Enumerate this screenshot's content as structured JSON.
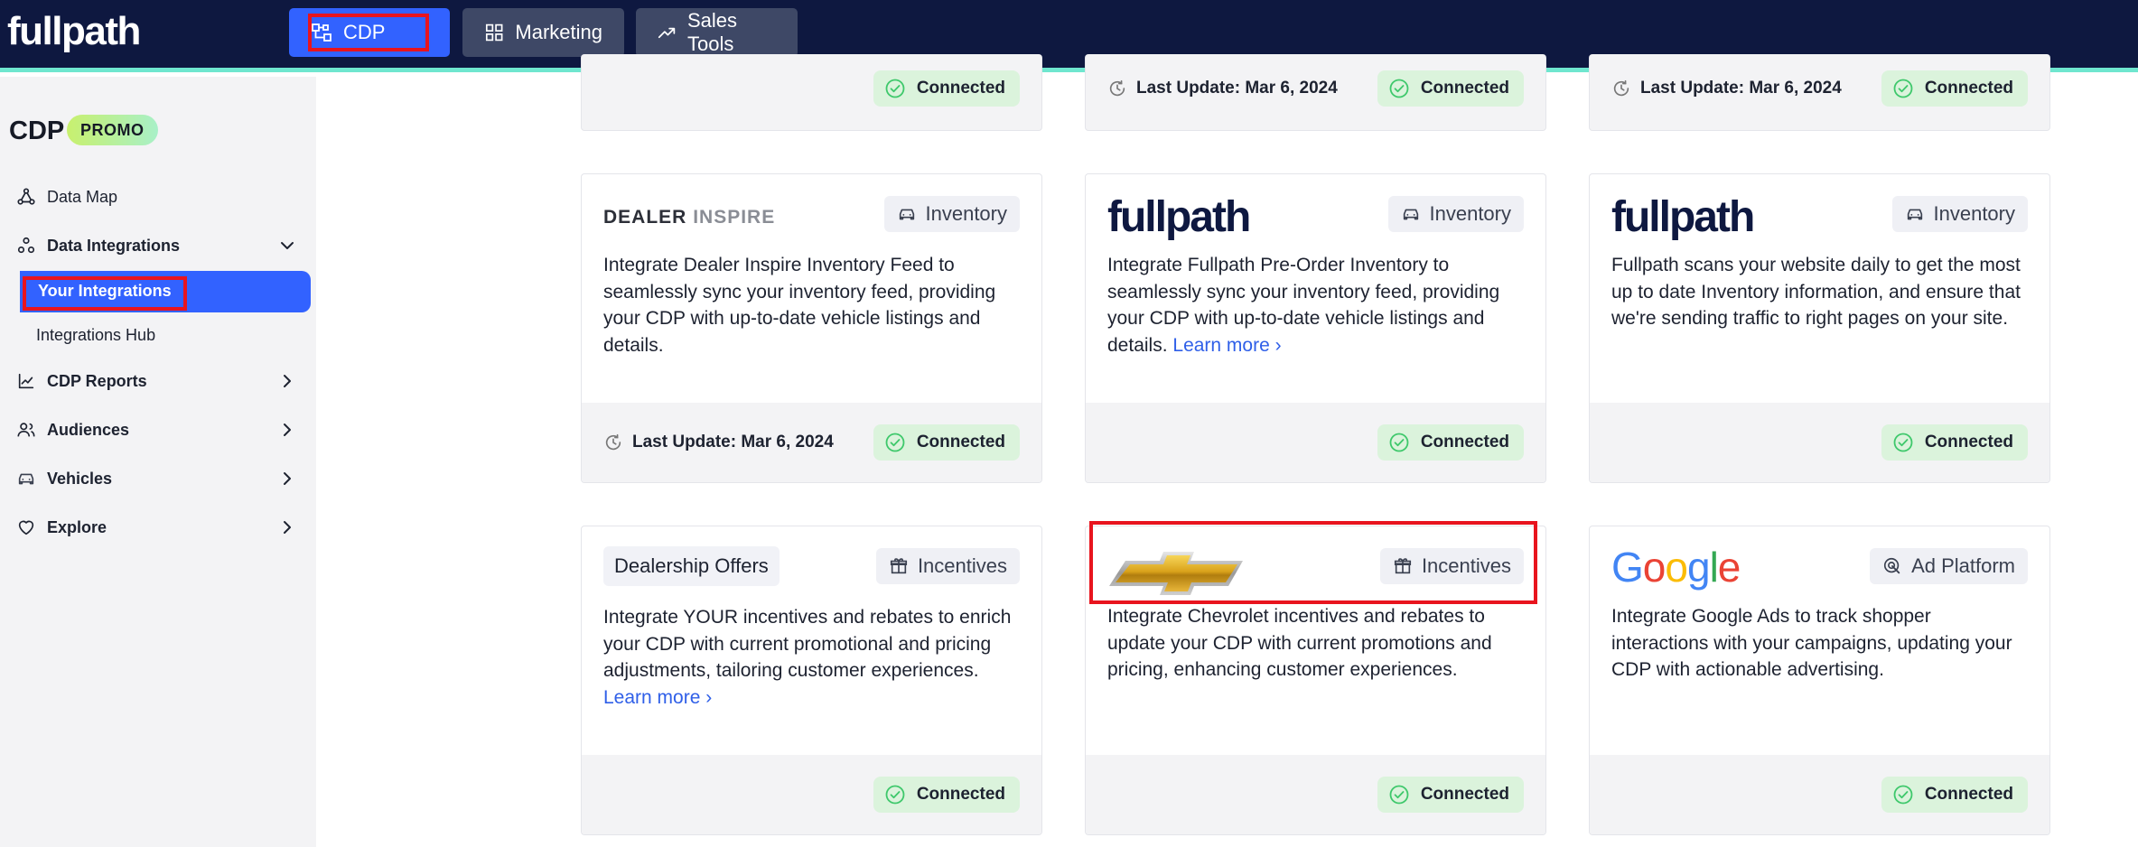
{
  "app": {
    "logo": "fullpath"
  },
  "topnav": [
    {
      "label": "CDP",
      "icon": "cdp-icon",
      "active": true
    },
    {
      "label": "Marketing",
      "icon": "grid-icon",
      "active": false
    },
    {
      "label": "Sales Tools",
      "icon": "trending-up-icon",
      "active": false
    }
  ],
  "sidebar": {
    "title": "CDP",
    "badge": "PROMO",
    "items": [
      {
        "label": "Data Map",
        "icon": "data-map-icon"
      },
      {
        "label": "Data Integrations",
        "icon": "integrations-icon",
        "expanded": true,
        "children": [
          {
            "label": "Your Integrations",
            "active": true
          },
          {
            "label": "Integrations Hub"
          }
        ]
      },
      {
        "label": "CDP Reports",
        "icon": "reports-icon"
      },
      {
        "label": "Audiences",
        "icon": "audiences-icon"
      },
      {
        "label": "Vehicles",
        "icon": "car-icon"
      },
      {
        "label": "Explore",
        "icon": "heart-icon"
      }
    ]
  },
  "status": {
    "connected": "Connected",
    "learn_more": "Learn more ›",
    "last_update": "Last Update: Mar 6, 2024"
  },
  "cards": [
    {
      "logo": "DEALER INSPIRE",
      "logo_a": "DEALER ",
      "logo_b": "INSPIRE",
      "tag": "Inventory",
      "desc": "Integrate Dealer Inspire Inventory Feed to seamlessly sync your inventory feed, providing your CDP with up-to-date vehicle listings and details."
    },
    {
      "logo": "fullpath",
      "tag": "Inventory",
      "desc": "Integrate Fullpath Pre-Order Inventory to seamlessly sync your inventory feed, providing your CDP with up-to-date vehicle listings and details."
    },
    {
      "logo": "fullpath",
      "tag": "Inventory",
      "desc": "Fullpath scans your website daily to get the most up to date Inventory information, and ensure that we're sending traffic to right pages on your site."
    },
    {
      "logo": "Dealership Offers",
      "tag": "Incentives",
      "desc": "Integrate YOUR incentives and rebates to enrich your CDP with current promotional and pricing adjustments, tailoring customer experiences."
    },
    {
      "logo": "chevrolet-bowtie",
      "tag": "Incentives",
      "desc": "Integrate Chevrolet incentives and rebates to update your CDP with current promotions and pricing, enhancing customer experiences."
    },
    {
      "logo": "Google",
      "tag": "Ad Platform",
      "desc": "Integrate Google Ads to track shopper interactions with your campaigns, updating your CDP with actionable advertising."
    }
  ],
  "colors": {
    "navy": "#0e1840",
    "accent": "#3262ff",
    "connected_bg": "#dbf3dc",
    "connected_check": "#3ec86b",
    "highlight": "#e8141e"
  }
}
